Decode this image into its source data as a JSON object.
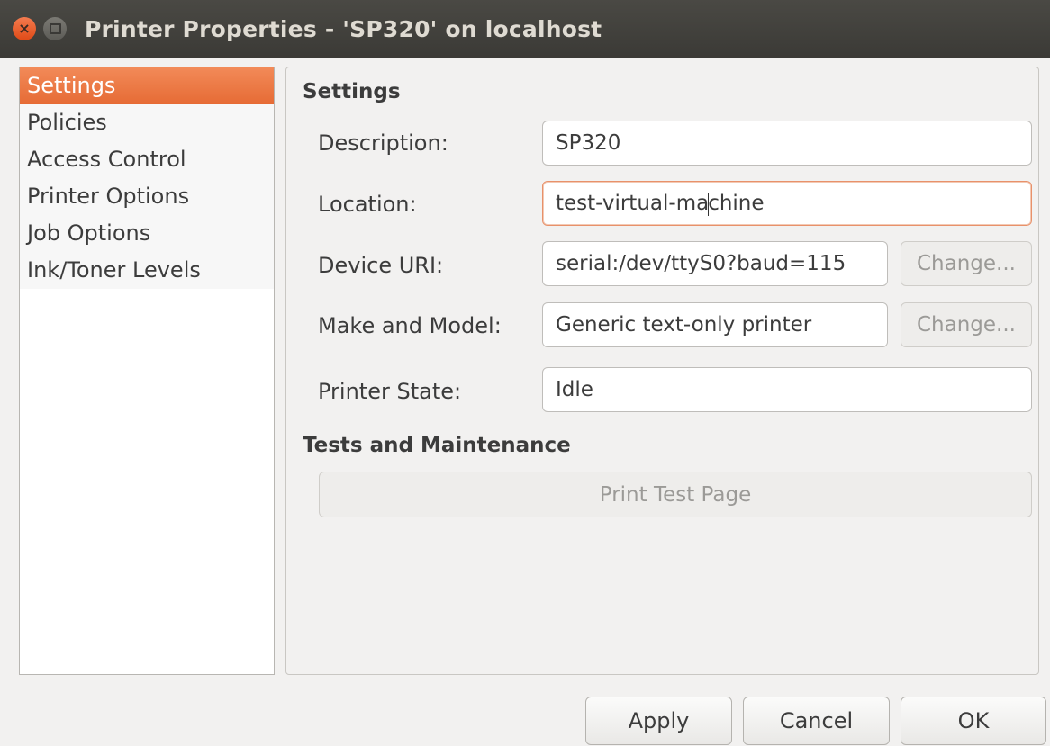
{
  "window": {
    "title": "Printer Properties - 'SP320' on localhost"
  },
  "sidebar": {
    "items": [
      {
        "label": "Settings",
        "selected": true
      },
      {
        "label": "Policies",
        "selected": false
      },
      {
        "label": "Access Control",
        "selected": false
      },
      {
        "label": "Printer Options",
        "selected": false
      },
      {
        "label": "Job Options",
        "selected": false
      },
      {
        "label": "Ink/Toner Levels",
        "selected": false
      }
    ]
  },
  "settings": {
    "heading": "Settings",
    "description": {
      "label": "Description:",
      "value": "SP320"
    },
    "location": {
      "label": "Location:",
      "value_before_caret": "test-virtual-ma",
      "value_after_caret": "chine"
    },
    "device_uri": {
      "label": "Device URI:",
      "value": "serial:/dev/ttyS0?baud=115",
      "button": "Change..."
    },
    "make_model": {
      "label": "Make and Model:",
      "value": "Generic text-only printer",
      "button": "Change..."
    },
    "printer_state": {
      "label": "Printer State:",
      "value": "Idle"
    }
  },
  "maintenance": {
    "heading": "Tests and Maintenance",
    "print_test_page": "Print Test Page"
  },
  "footer": {
    "apply": "Apply",
    "cancel": "Cancel",
    "ok": "OK"
  },
  "colors": {
    "accent": "#e8723e",
    "titlebar": "#3f3e3a",
    "close_button": "#e55b2a"
  }
}
